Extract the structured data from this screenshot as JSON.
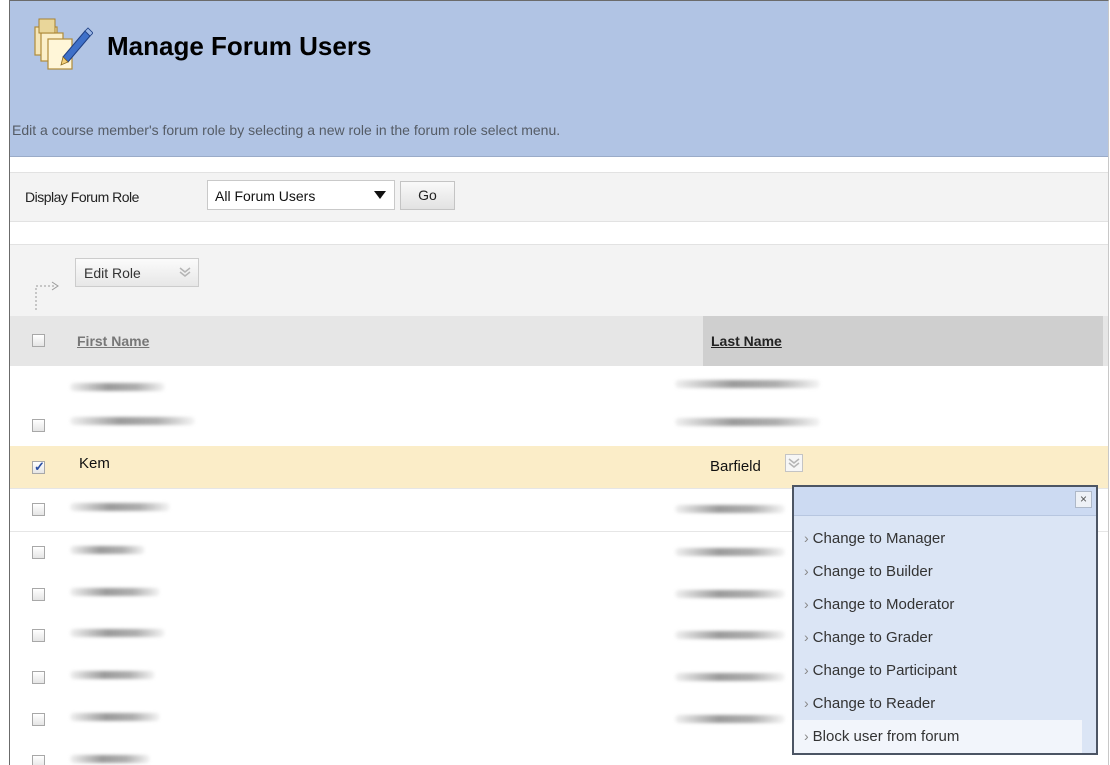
{
  "header": {
    "title": "Manage Forum Users",
    "instructions": "Edit a course member's forum role by selecting a new role in the forum role select menu."
  },
  "filter": {
    "label": "Display Forum Role",
    "selected": "All Forum Users",
    "go_label": "Go"
  },
  "actions": {
    "edit_role_label": "Edit Role"
  },
  "table": {
    "columns": [
      "First Name",
      "Last Name"
    ],
    "selected_row": {
      "first_name": "Kem",
      "last_name": "Barfield"
    }
  },
  "role_menu": {
    "close_label": "×",
    "items": [
      "Change to Manager",
      "Change to Builder",
      "Change to Moderator",
      "Change to Grader",
      "Change to Participant",
      "Change to Reader",
      "Block user from forum"
    ]
  },
  "colors": {
    "header_bg": "#b1c4e4",
    "selected_row_bg": "#fbedc8",
    "menu_bg": "#dbe5f5"
  },
  "icons": {
    "header": "manage-users-icon",
    "context": "chevron-down-icon",
    "close": "close-icon"
  }
}
